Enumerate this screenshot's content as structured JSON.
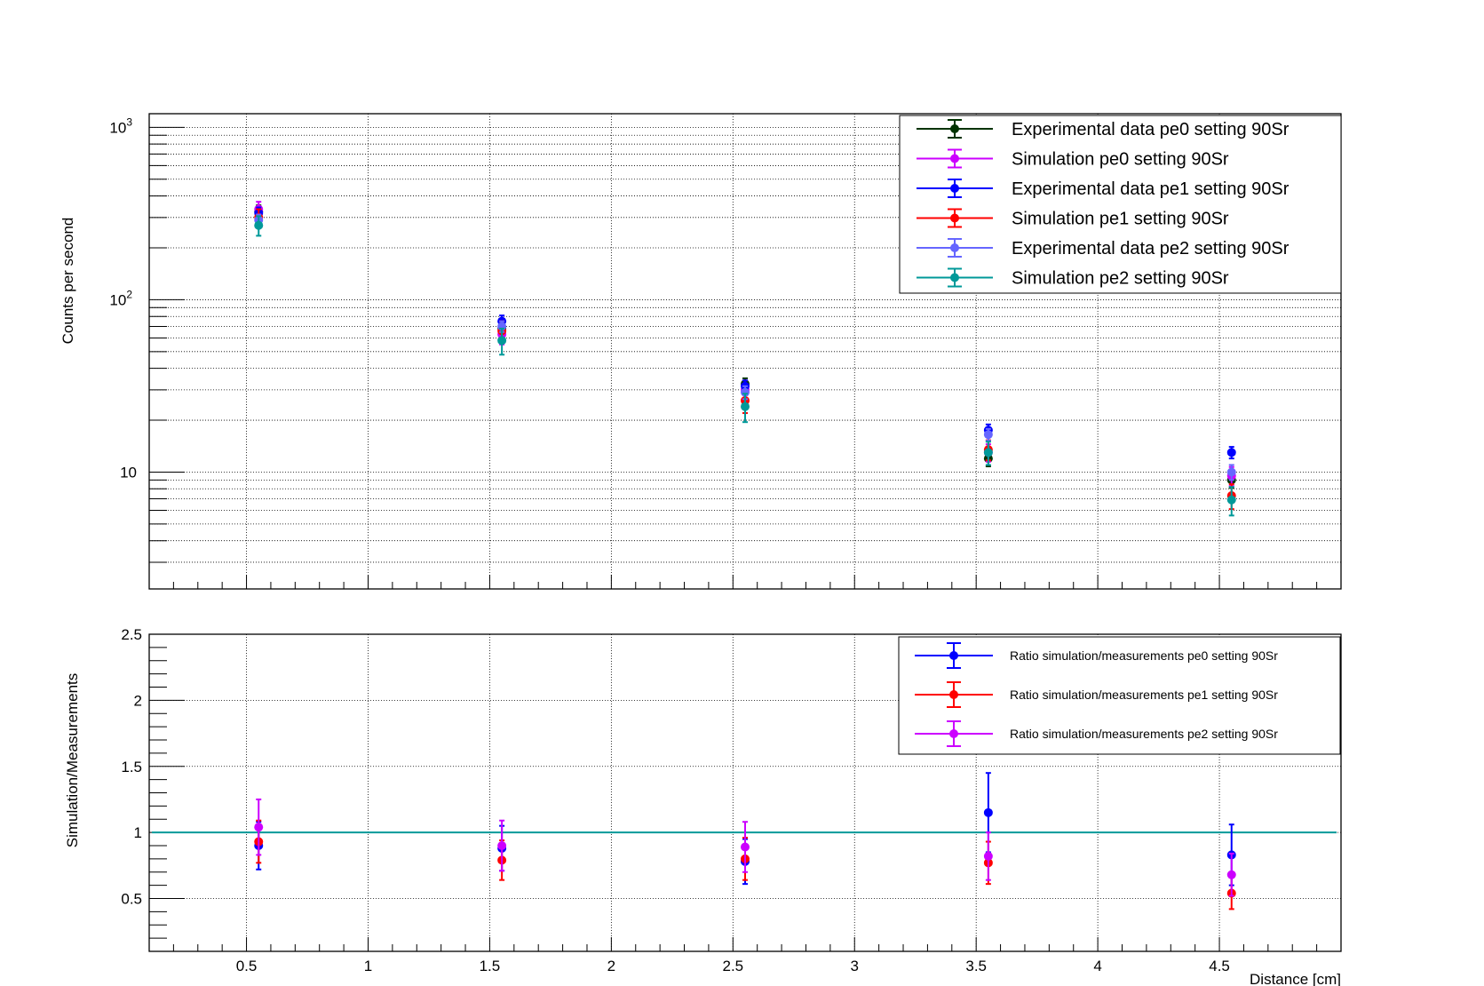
{
  "chart_data": [
    {
      "type": "scatter",
      "panel": "top",
      "ylabel": "Counts per second",
      "yscale": "log",
      "ylim": [
        2.1,
        1200
      ],
      "xlim": [
        0.1,
        5.0
      ],
      "grid": true,
      "legend_position": "top-right",
      "y_tick_labels": [
        {
          "label": "10",
          "value": 10
        },
        {
          "label": "10",
          "sup": "2",
          "value": 100
        },
        {
          "label": "10",
          "sup": "3",
          "value": 1000
        }
      ],
      "series": [
        {
          "name": "Experimental data pe0 setting 90Sr",
          "color": "#003300",
          "x": [
            0.55,
            1.55,
            2.55,
            3.55,
            4.55
          ],
          "y": [
            325,
            68,
            32.5,
            12,
            9
          ],
          "err": [
            28,
            6,
            2.5,
            1.2,
            0.9
          ]
        },
        {
          "name": "Simulation pe0 setting 90Sr",
          "color": "#cc00ff",
          "x": [
            0.55,
            1.55,
            2.55,
            3.55,
            4.55
          ],
          "y": [
            335,
            63,
            30,
            13,
            9.5
          ],
          "err": [
            35,
            8,
            4,
            1.5,
            1.2
          ]
        },
        {
          "name": "Experimental data pe1 setting 90Sr",
          "color": "#0000ff",
          "x": [
            0.55,
            1.55,
            2.55,
            3.55,
            4.55
          ],
          "y": [
            318,
            75,
            31.5,
            17.5,
            13
          ],
          "err": [
            25,
            6,
            2.5,
            1.4,
            1.0
          ]
        },
        {
          "name": "Simulation pe1 setting 90Sr",
          "color": "#ff0000",
          "x": [
            0.55,
            1.55,
            2.55,
            3.55,
            4.55
          ],
          "y": [
            300,
            66,
            26,
            13.5,
            7.3
          ],
          "err": [
            35,
            9,
            4,
            1.8,
            1.2
          ]
        },
        {
          "name": "Experimental data pe2 setting 90Sr",
          "color": "#6666ff",
          "x": [
            0.55,
            1.55,
            2.55,
            3.55,
            4.55
          ],
          "y": [
            290,
            70,
            29,
            16.5,
            10
          ],
          "err": [
            22,
            5,
            2.5,
            1.3,
            1.0
          ]
        },
        {
          "name": "Simulation pe2 setting 90Sr",
          "color": "#009999",
          "x": [
            0.55,
            1.55,
            2.55,
            3.55,
            4.55
          ],
          "y": [
            270,
            58,
            24,
            13,
            6.9
          ],
          "err": [
            35,
            10,
            4.5,
            2.0,
            1.3
          ]
        }
      ]
    },
    {
      "type": "scatter",
      "panel": "bottom",
      "xlabel": "Distance [cm]",
      "ylabel": "Simulation/Measurements",
      "ylim": [
        0.1,
        2.5
      ],
      "xlim": [
        0.1,
        5.0
      ],
      "grid": true,
      "legend_position": "top-right",
      "x_tick_labels": [
        "0.5",
        "1",
        "1.5",
        "2",
        "2.5",
        "3",
        "3.5",
        "4",
        "4.5"
      ],
      "x_tick_values": [
        0.5,
        1,
        1.5,
        2,
        2.5,
        3,
        3.5,
        4,
        4.5
      ],
      "y_tick_labels": [
        "0.5",
        "1",
        "1.5",
        "2",
        "2.5"
      ],
      "y_tick_values": [
        0.5,
        1,
        1.5,
        2,
        2.5
      ],
      "reference_line": {
        "y": 1,
        "color": "#009999"
      },
      "series": [
        {
          "name": "Ratio simulation/measurements pe0 setting 90Sr",
          "color": "#0000ff",
          "x": [
            0.55,
            1.55,
            2.55,
            3.55,
            4.55
          ],
          "y": [
            0.9,
            0.88,
            0.78,
            1.15,
            0.83
          ],
          "err": [
            0.18,
            0.17,
            0.17,
            0.3,
            0.23
          ]
        },
        {
          "name": "Ratio simulation/measurements pe1 setting 90Sr",
          "color": "#ff0000",
          "x": [
            0.55,
            1.55,
            2.55,
            3.55,
            4.55
          ],
          "y": [
            0.93,
            0.79,
            0.8,
            0.77,
            0.54
          ],
          "err": [
            0.16,
            0.15,
            0.16,
            0.16,
            0.12
          ]
        },
        {
          "name": "Ratio simulation/measurements pe2 setting 90Sr",
          "color": "#cc00ff",
          "x": [
            0.55,
            1.55,
            2.55,
            3.55,
            4.55
          ],
          "y": [
            1.04,
            0.9,
            0.89,
            0.82,
            0.68
          ],
          "err": [
            0.21,
            0.19,
            0.19,
            0.18,
            0.16
          ]
        }
      ]
    }
  ]
}
